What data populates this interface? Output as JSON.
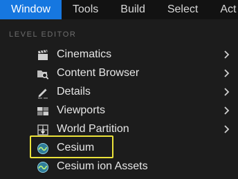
{
  "menubar": {
    "items": [
      {
        "label": "Window"
      },
      {
        "label": "Tools"
      },
      {
        "label": "Build"
      },
      {
        "label": "Select"
      },
      {
        "label": "Act"
      }
    ],
    "active_color": "#1677e0"
  },
  "panel": {
    "section": "LEVEL EDITOR",
    "entries": [
      {
        "label": "Cinematics",
        "icon": "clapperboard-icon",
        "submenu": true
      },
      {
        "label": "Content Browser",
        "icon": "content-browser-icon",
        "submenu": true
      },
      {
        "label": "Details",
        "icon": "details-pencil-icon",
        "submenu": true
      },
      {
        "label": "Viewports",
        "icon": "viewports-grid-icon",
        "submenu": true
      },
      {
        "label": "World Partition",
        "icon": "world-partition-icon",
        "submenu": true
      },
      {
        "label": "Cesium",
        "icon": "cesium-globe-icon",
        "submenu": false,
        "highlighted": true
      },
      {
        "label": "Cesium ion Assets",
        "icon": "cesium-globe-icon",
        "submenu": false
      }
    ],
    "highlight_color": "#ece33a"
  }
}
